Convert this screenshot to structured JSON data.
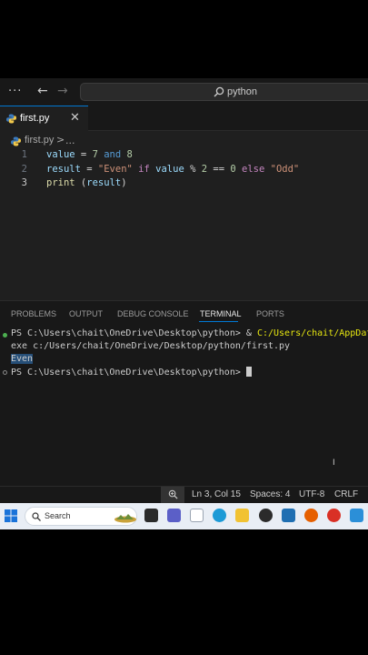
{
  "titlebar": {
    "search_text": "python"
  },
  "tab": {
    "label": "first.py"
  },
  "breadcrumb": {
    "file": "first.py",
    "separator": ">",
    "more": "..."
  },
  "editor": {
    "lines": [
      {
        "number": "1",
        "parts": [
          [
            "var",
            "value"
          ],
          [
            "op",
            " = "
          ],
          [
            "num",
            "7"
          ],
          [
            "op",
            " "
          ],
          [
            "kw",
            "and"
          ],
          [
            "op",
            " "
          ],
          [
            "num",
            "8"
          ]
        ]
      },
      {
        "number": "2",
        "parts": [
          [
            "var",
            "result"
          ],
          [
            "op",
            " = "
          ],
          [
            "str",
            "\"Even\""
          ],
          [
            "op",
            " "
          ],
          [
            "kw2",
            "if"
          ],
          [
            "op",
            " "
          ],
          [
            "var",
            "value"
          ],
          [
            "op",
            " % "
          ],
          [
            "num",
            "2"
          ],
          [
            "op",
            " == "
          ],
          [
            "num",
            "0"
          ],
          [
            "op",
            " "
          ],
          [
            "kw2",
            "else"
          ],
          [
            "op",
            " "
          ],
          [
            "str",
            "\"Odd\""
          ]
        ]
      },
      {
        "number": "3",
        "parts": [
          [
            "fn",
            "print"
          ],
          [
            "op",
            " ("
          ],
          [
            "var",
            "result"
          ],
          [
            "op",
            ")"
          ]
        ]
      }
    ]
  },
  "panel": {
    "tabs": [
      "PROBLEMS",
      "OUTPUT",
      "DEBUG CONSOLE",
      "TERMINAL",
      "PORTS"
    ],
    "active_tab": "TERMINAL",
    "terminal": {
      "line1_prompt": "PS C:\\Users\\chait\\OneDrive\\Desktop\\python> & ",
      "line1_cmd": "C:/Users/chait/AppData/",
      "line2": "exe c:/Users/chait/OneDrive/Desktop/python/first.py",
      "line3_output": "Even",
      "line4_prompt": "PS C:\\Users\\chait\\OneDrive\\Desktop\\python> "
    }
  },
  "statusbar": {
    "position": "Ln 3, Col 15",
    "spaces": "Spaces: 4",
    "encoding": "UTF-8",
    "eol": "CRLF"
  },
  "taskbar": {
    "search_text": "Search"
  },
  "colors": {
    "accent": "#0078d4",
    "terminal_yellow": "#e5e510",
    "selection": "#264f78"
  }
}
